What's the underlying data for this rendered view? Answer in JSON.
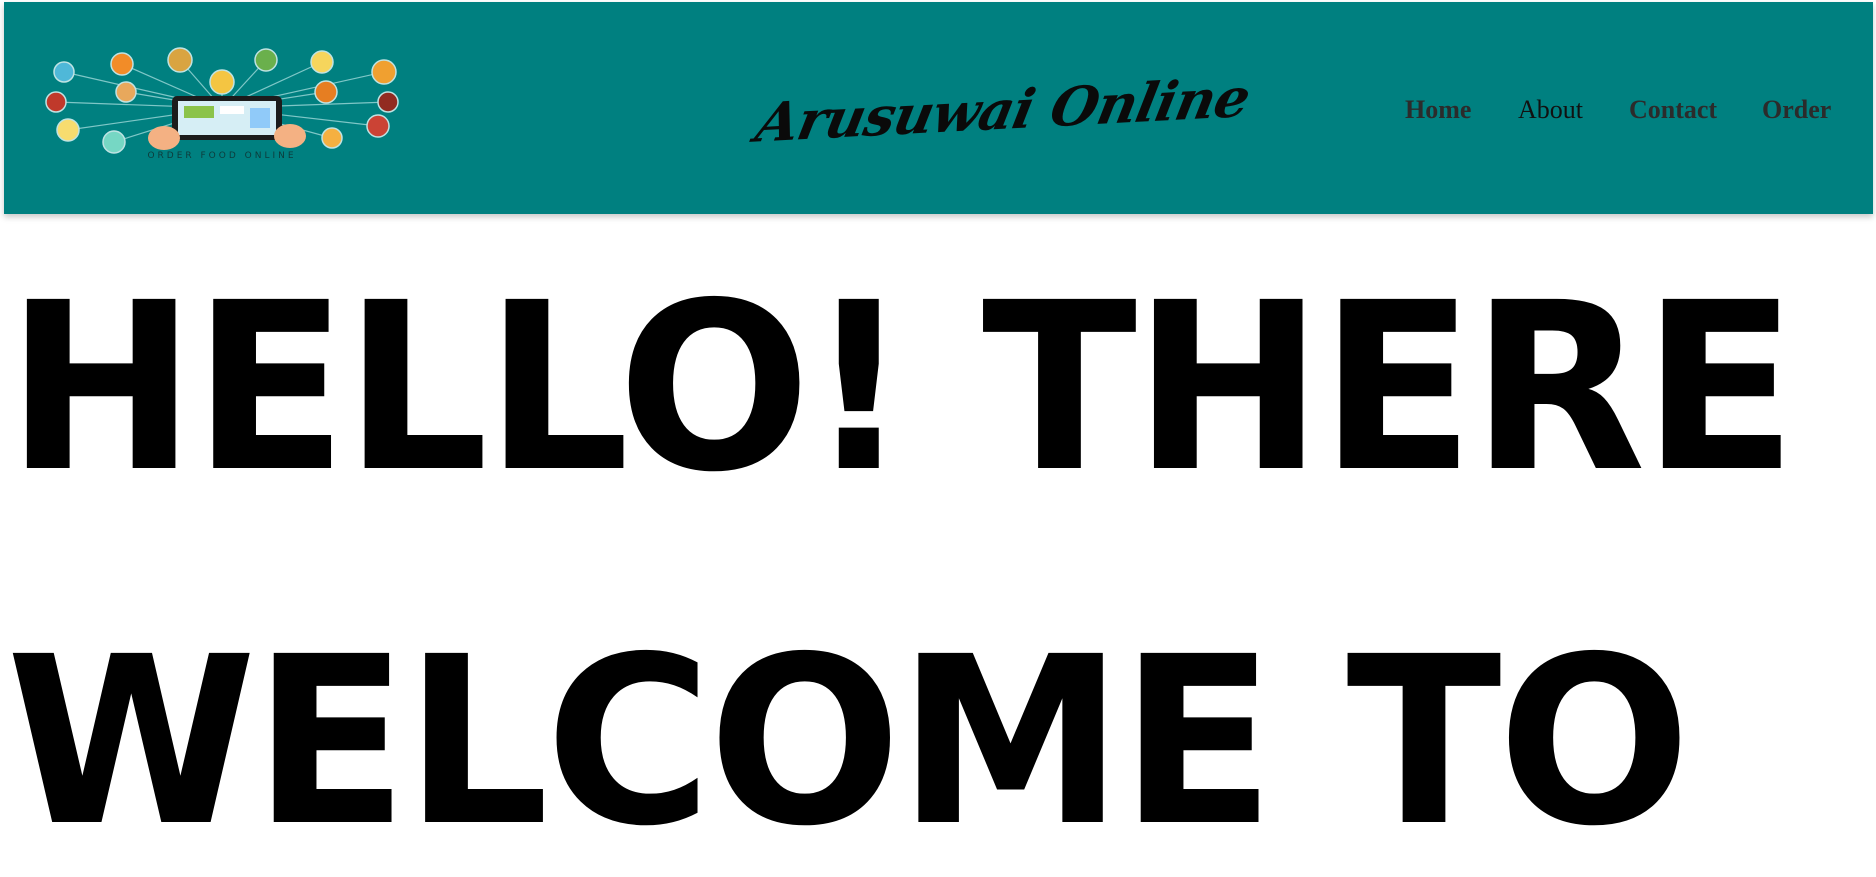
{
  "header": {
    "logo_caption": "ORDER FOOD ONLINE",
    "brand": "Arusuwai Online",
    "background_color": "#008080"
  },
  "nav": {
    "home": "Home",
    "about": "About",
    "contact": "Contact",
    "order": "Order"
  },
  "hero": {
    "line1": "HELLO! THERE",
    "line2": "WELCOME TO"
  }
}
